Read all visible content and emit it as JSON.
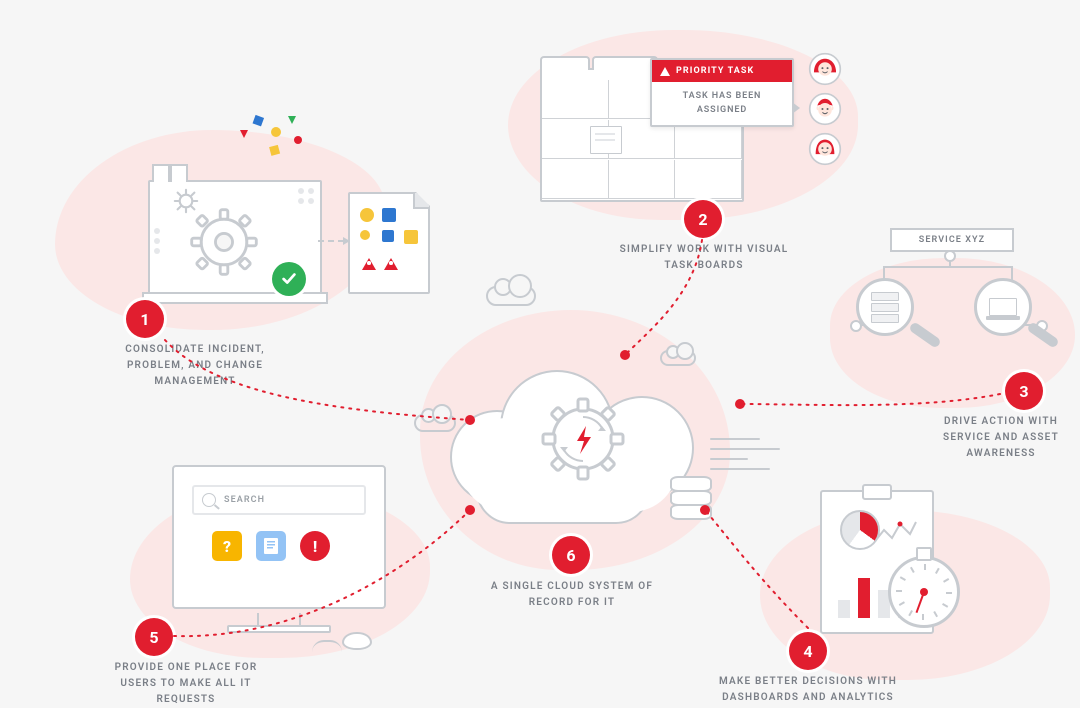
{
  "nodes": {
    "n1": {
      "number": "1",
      "label": "CONSOLIDATE INCIDENT, PROBLEM, AND CHANGE MANAGEMENT"
    },
    "n2": {
      "number": "2",
      "label": "SIMPLIFY WORK WITH VISUAL TASK BOARDS"
    },
    "n3": {
      "number": "3",
      "label": "DRIVE ACTION WITH SERVICE AND ASSET AWARENESS"
    },
    "n4": {
      "number": "4",
      "label": "MAKE BETTER DECISIONS WITH DASHBOARDS AND ANALYTICS"
    },
    "n5": {
      "number": "5",
      "label": "PROVIDE ONE PLACE FOR USERS TO MAKE ALL IT REQUESTS"
    },
    "n6": {
      "number": "6",
      "label": "A SINGLE CLOUD SYSTEM OF RECORD FOR IT"
    }
  },
  "node2": {
    "popup_header": "PRIORITY TASK",
    "popup_body": "TASK HAS BEEN ASSIGNED"
  },
  "node3": {
    "service_label": "SERVICE XYZ"
  },
  "node5": {
    "search_placeholder": "SEARCH"
  }
}
